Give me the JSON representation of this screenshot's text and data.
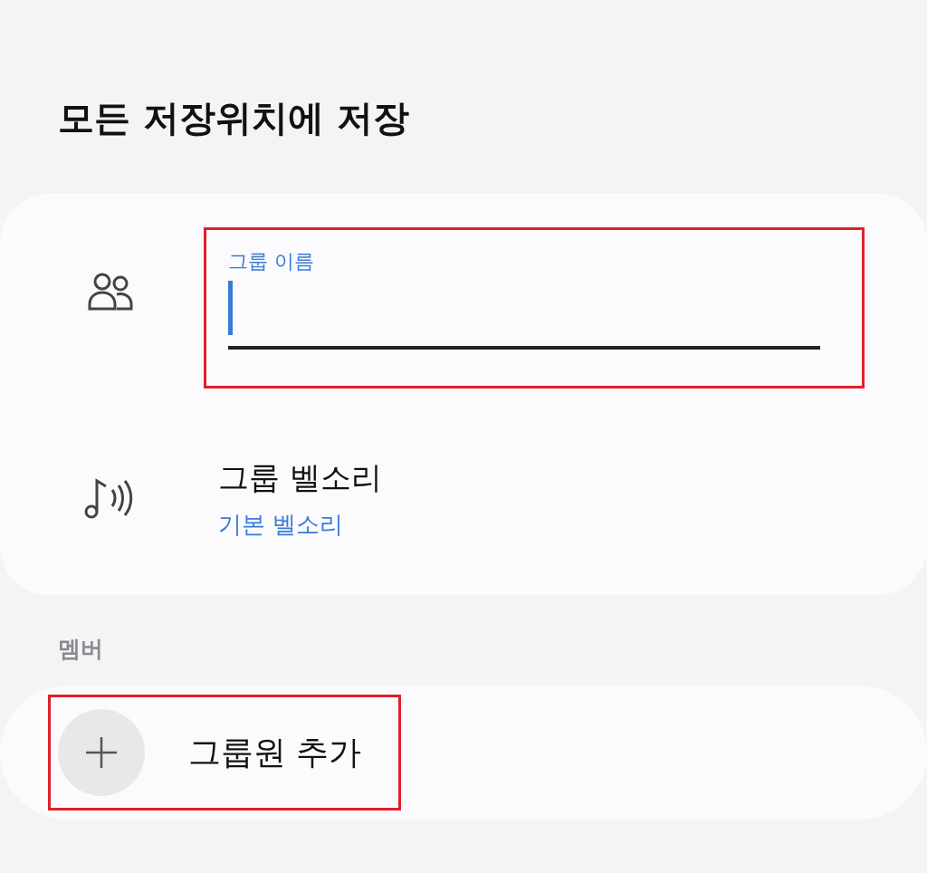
{
  "title": "모든 저장위치에 저장",
  "group_name_field": {
    "label": "그룹 이름",
    "focused": true,
    "highlighted": true
  },
  "ringtone": {
    "title": "그룹 벨소리",
    "value": "기본 벨소리"
  },
  "members_section": {
    "header": "멤버",
    "add_button": {
      "label": "그룹원 추가",
      "highlighted": true
    }
  }
}
